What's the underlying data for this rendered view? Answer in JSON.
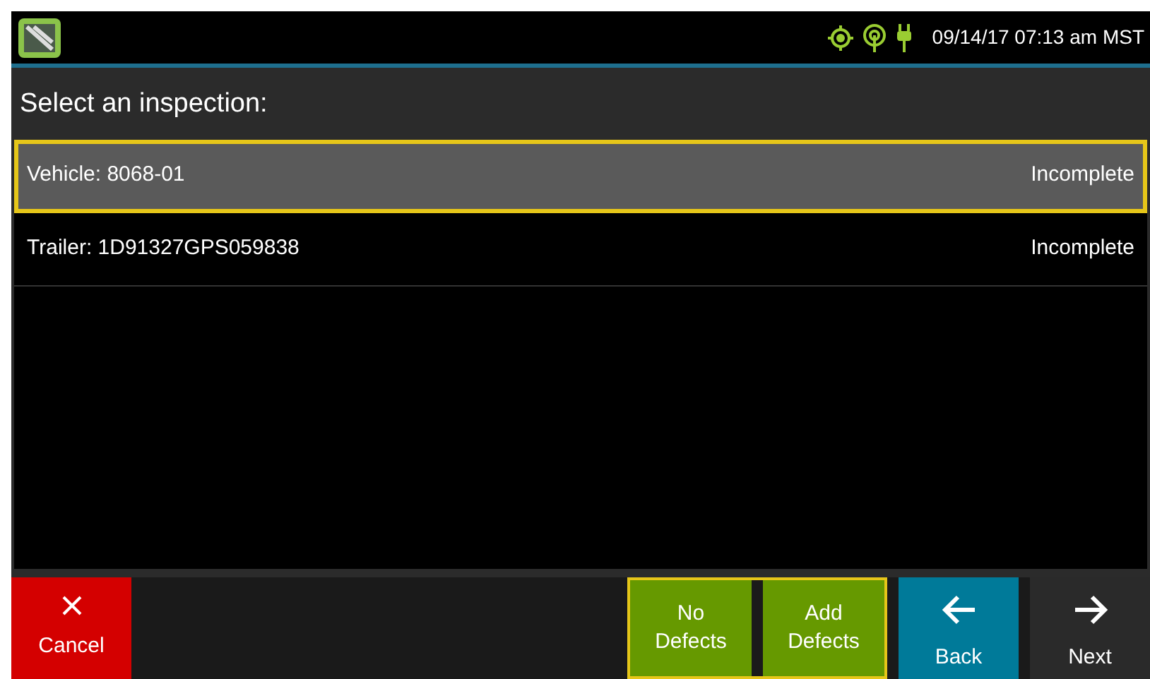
{
  "status_bar": {
    "datetime": "09/14/17 07:13 am MST"
  },
  "title": "Select an inspection:",
  "inspections": [
    {
      "label": "Vehicle: 8068-01",
      "status": "Incomplete",
      "selected": true
    },
    {
      "label": "Trailer: 1D91327GPS059838",
      "status": "Incomplete",
      "selected": false
    }
  ],
  "buttons": [
    {
      "kind": "cancel",
      "label": "Cancel"
    },
    {
      "kind": "defects",
      "label": "No Defects"
    },
    {
      "kind": "defects",
      "label": "Add Defects"
    },
    {
      "kind": "back",
      "label": "Back"
    },
    {
      "kind": "next",
      "label": "Next"
    }
  ]
}
